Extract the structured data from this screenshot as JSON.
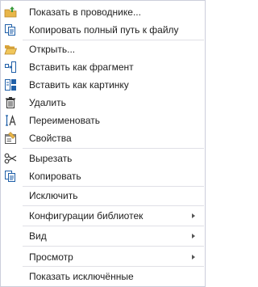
{
  "menu": {
    "items": [
      {
        "label": "Показать в проводнике...",
        "icon": "folder-up-icon"
      },
      {
        "label": "Копировать полный путь к файлу",
        "icon": "copy-path-icon"
      },
      {
        "label": "Открыть...",
        "icon": "open-folder-icon"
      },
      {
        "label": "Вставить как фрагмент",
        "icon": "insert-fragment-icon"
      },
      {
        "label": "Вставить как картинку",
        "icon": "insert-picture-icon"
      },
      {
        "label": "Удалить",
        "icon": "trash-icon"
      },
      {
        "label": "Переименовать",
        "icon": "rename-icon"
      },
      {
        "label": "Свойства",
        "icon": "properties-icon"
      },
      {
        "label": "Вырезать",
        "icon": "scissors-icon"
      },
      {
        "label": "Копировать",
        "icon": "copy-icon"
      },
      {
        "label": "Исключить",
        "icon": ""
      },
      {
        "label": "Конфигурации библиотек",
        "icon": "",
        "submenu": true
      },
      {
        "label": "Вид",
        "icon": "",
        "submenu": true
      },
      {
        "label": "Просмотр",
        "icon": "",
        "submenu": true
      },
      {
        "label": "Показать исключённые",
        "icon": ""
      }
    ]
  },
  "colors": {
    "border": "#cccedb",
    "separator": "#e0e0e6",
    "text": "#1e1e1e",
    "icon_blue": "#1f5fa8",
    "icon_folder": "#e8b64a",
    "icon_green": "#3a9a3a"
  }
}
